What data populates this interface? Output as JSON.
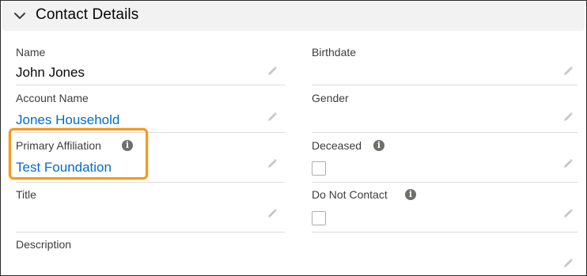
{
  "section": {
    "title": "Contact Details",
    "expanded_icon": "chevron-down-icon"
  },
  "left": {
    "name": {
      "label": "Name",
      "value": "John Jones"
    },
    "account_name": {
      "label": "Account Name",
      "value": "Jones Household"
    },
    "primary_affiliation": {
      "label": "Primary Affiliation",
      "value": "Test Foundation"
    },
    "title": {
      "label": "Title",
      "value": ""
    },
    "description": {
      "label": "Description",
      "value": ""
    }
  },
  "right": {
    "birthdate": {
      "label": "Birthdate",
      "value": ""
    },
    "gender": {
      "label": "Gender",
      "value": ""
    },
    "deceased": {
      "label": "Deceased",
      "checked": false
    },
    "do_not_contact": {
      "label": "Do Not Contact",
      "checked": false
    }
  },
  "icons": {
    "edit": "pencil-icon",
    "help": "info-icon"
  },
  "colors": {
    "link": "#006dcc",
    "highlight": "#f39a1d",
    "header_bg": "#f3f2f2"
  }
}
